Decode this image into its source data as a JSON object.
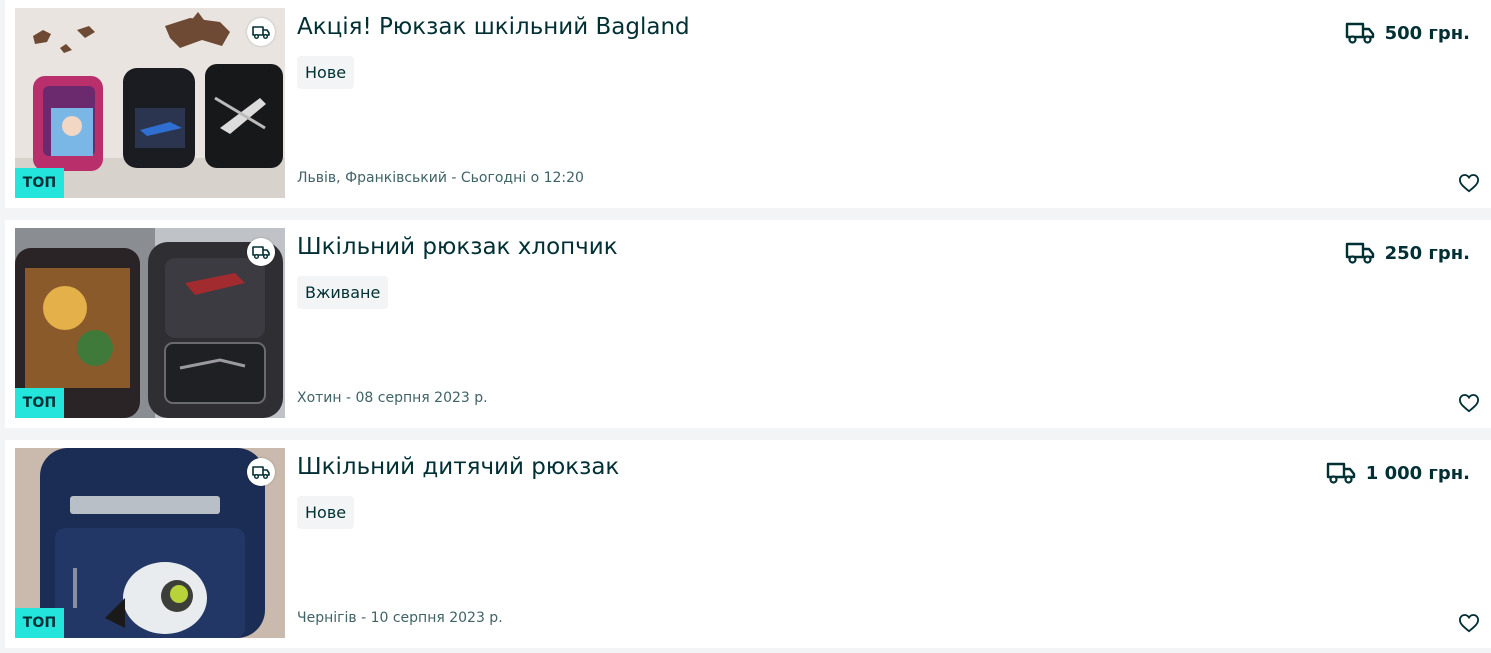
{
  "listings": [
    {
      "title": "Акція! Рюкзак шкільний Bagland",
      "condition": "Нове",
      "location": "Львів, Франківський - Сьогодні о 12:20",
      "price": "500 грн.",
      "badge": "ТОП",
      "delivery_icon": "truck-icon",
      "favorite_icon": "heart-icon"
    },
    {
      "title": "Шкільний рюкзак хлопчик",
      "condition": "Вживане",
      "location": "Хотин - 08 серпня 2023 р.",
      "price": "250 грн.",
      "badge": "ТОП",
      "delivery_icon": "truck-icon",
      "favorite_icon": "heart-icon"
    },
    {
      "title": "Шкільний дитячий рюкзак",
      "condition": "Нове",
      "location": "Чернігів - 10 серпня 2023 р.",
      "price": "1 000 грн.",
      "badge": "ТОП",
      "delivery_icon": "truck-icon",
      "favorite_icon": "heart-icon"
    }
  ],
  "colors": {
    "text": "#002f34",
    "muted": "#406367",
    "top_badge": "#23e5db",
    "tag_bg": "#f2f4f5",
    "page_bg": "#f2f4f5"
  }
}
